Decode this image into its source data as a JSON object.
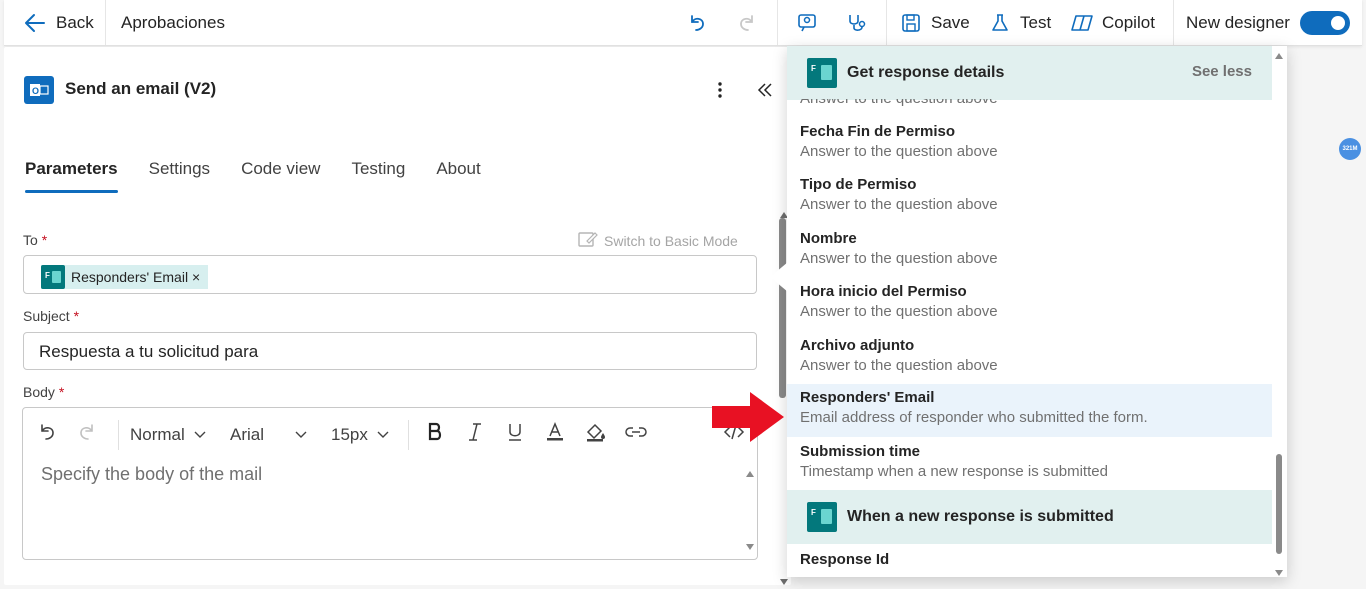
{
  "topbar": {
    "back_label": "Back",
    "flow_name": "Aprobaciones",
    "save_label": "Save",
    "test_label": "Test",
    "copilot_label": "Copilot",
    "new_designer_label": "New designer",
    "new_designer_on": true
  },
  "panel": {
    "title": "Send an email (V2)",
    "tabs": [
      "Parameters",
      "Settings",
      "Code view",
      "Testing",
      "About"
    ],
    "active_tab": "Parameters",
    "switch_mode_label": "Switch to Basic Mode",
    "to_label": "To",
    "to_token": "Responders' Email ×",
    "subject_label": "Subject",
    "subject_value": "Respuesta a tu solicitud para",
    "body_label": "Body",
    "body_placeholder": "Specify the body of the mail",
    "required_marker": "*",
    "toolbar": {
      "paragraph_style": "Normal",
      "font": "Arial",
      "font_size": "15px"
    }
  },
  "dropdown": {
    "section1_title": "Get response details",
    "see_less_label": "See less",
    "partial_desc": "Answer to the question above",
    "items": [
      {
        "name": "Fecha Fin de Permiso",
        "desc": "Answer to the question above"
      },
      {
        "name": "Tipo de Permiso",
        "desc": "Answer to the question above"
      },
      {
        "name": "Nombre",
        "desc": "Answer to the question above"
      },
      {
        "name": "Hora inicio del Permiso",
        "desc": "Answer to the question above"
      },
      {
        "name": "Archivo adjunto",
        "desc": "Answer to the question above"
      },
      {
        "name": "Responders' Email",
        "desc": "Email address of responder who submitted the form."
      },
      {
        "name": "Submission time",
        "desc": "Timestamp when a new response is submitted"
      }
    ],
    "section2_title": "When a new response is submitted",
    "section2_items": [
      {
        "name": "Response Id"
      }
    ]
  },
  "badge_text": "321M",
  "colors": {
    "accent": "#0f6cbd",
    "forms_teal": "#03787c",
    "header_bg": "#e1f0ef",
    "highlight_bg": "#eaf3fb",
    "red_arrow": "#e81123"
  }
}
